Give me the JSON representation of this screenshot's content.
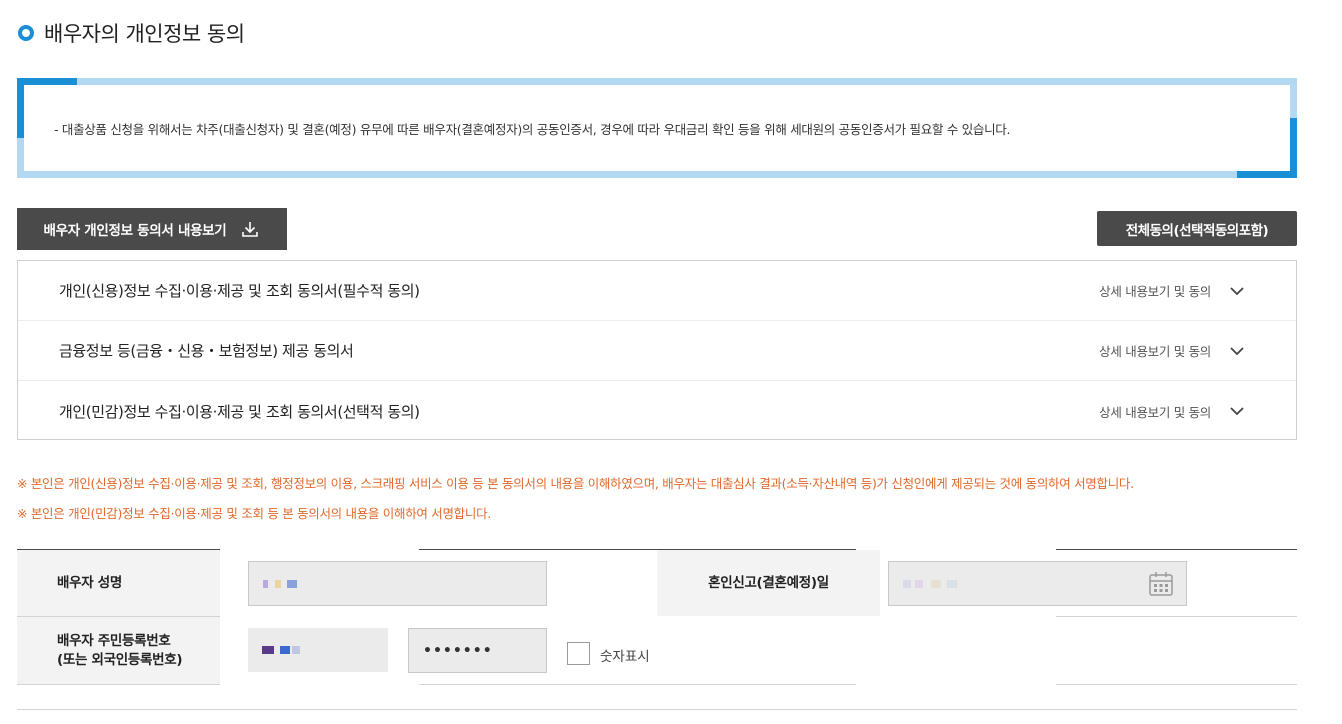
{
  "title": "배우자의 개인정보 동의",
  "notice": "- 대출상품 신청을 위해서는 차주(대출신청자) 및 결혼(예정) 유무에 따른 배우자(결혼예정자)의 공동인증서, 경우에 따라 우대금리 확인 등을 위해 세대원의 공동인증서가 필요할 수 있습니다.",
  "buttons": {
    "view_consent": "배우자 개인정보 동의서 내용보기",
    "agree_all": "전체동의(선택적동의포함)"
  },
  "accordion": [
    {
      "title": "개인(신용)정보 수집·이용·제공 및 조회 동의서(필수적 동의)",
      "detail": "상세 내용보기 및 동의"
    },
    {
      "title": "금융정보 등(금융・신용・보험정보) 제공 동의서",
      "detail": "상세 내용보기 및 동의"
    },
    {
      "title": "개인(민감)정보 수집·이용·제공 및 조회 동의서(선택적 동의)",
      "detail": "상세 내용보기 및 동의"
    }
  ],
  "warnings": [
    "※ 본인은 개인(신용)정보 수집·이용·제공 및 조회, 행정정보의 이용, 스크래핑 서비스 이용 등 본 동의서의 내용을 이해하였으며, 배우자는 대출심사 결과(소득·자산내역 등)가 신청인에게 제공되는 것에 동의하여 서명합니다.",
    "※ 본인은 개인(민감)정보 수집·이용·제공 및 조회 등 본 동의서의 내용을 이해하여 서명합니다."
  ],
  "form": {
    "spouse_name_label": "배우자 성명",
    "marriage_date_label": "혼인신고(결혼예정)일",
    "rrn_label_line1": "배우자 주민등록번호",
    "rrn_label_line2": "(또는 외국인등록번호)",
    "rrn_back_masked": "•••••••",
    "show_digits_label": "숫자표시"
  },
  "colors": {
    "accent": "#1a8fd6",
    "notice_border": "#b3d8f2",
    "button_bg": "#4a4a4a",
    "warning": "#e0692b"
  },
  "icons": {
    "title_bullet": "circle-bullet-icon",
    "download": "download-icon",
    "chevron": "chevron-down-icon",
    "calendar": "calendar-icon"
  }
}
